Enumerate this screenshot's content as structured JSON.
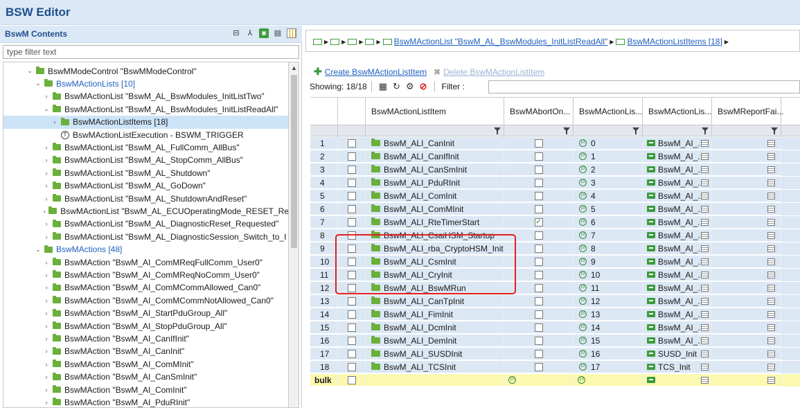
{
  "editor": {
    "title": "BSW Editor"
  },
  "left": {
    "header": "BswM Contents",
    "filter_placeholder": "type filter text",
    "tree": [
      {
        "label": "BswMModeControl \"BswMModeControl\"",
        "indent": 1,
        "chev": "v",
        "kind": "folder"
      },
      {
        "label": "BswMActionLists [10]",
        "indent": 2,
        "chev": "v",
        "kind": "folder",
        "blue": true
      },
      {
        "label": "BswMActionList \"BswM_AL_BswModules_InitListTwo\"",
        "indent": 3,
        "chev": ">",
        "kind": "folder"
      },
      {
        "label": "BswMActionList \"BswM_AL_BswModules_InitListReadAll\"",
        "indent": 3,
        "chev": "v",
        "kind": "folder"
      },
      {
        "label": "BswMActionListItems [18]",
        "indent": 4,
        "chev": ">",
        "kind": "folder",
        "selected": true
      },
      {
        "label": "BswMActionListExecution - BSWM_TRIGGER",
        "indent": 4,
        "chev": "",
        "kind": "t"
      },
      {
        "label": "BswMActionList \"BswM_AL_FullComm_AllBus\"",
        "indent": 3,
        "chev": ">",
        "kind": "folder"
      },
      {
        "label": "BswMActionList \"BswM_AL_StopComm_AllBus\"",
        "indent": 3,
        "chev": ">",
        "kind": "folder"
      },
      {
        "label": "BswMActionList \"BswM_AL_Shutdown\"",
        "indent": 3,
        "chev": ">",
        "kind": "folder"
      },
      {
        "label": "BswMActionList \"BswM_AL_GoDown\"",
        "indent": 3,
        "chev": ">",
        "kind": "folder"
      },
      {
        "label": "BswMActionList \"BswM_AL_ShutdownAndReset\"",
        "indent": 3,
        "chev": ">",
        "kind": "folder"
      },
      {
        "label": "BswMActionList \"BswM_AL_ECUOperatingMode_RESET_Re",
        "indent": 3,
        "chev": ">",
        "kind": "folder"
      },
      {
        "label": "BswMActionList \"BswM_AL_DiagnosticReset_Requested\"",
        "indent": 3,
        "chev": ">",
        "kind": "folder"
      },
      {
        "label": "BswMActionList \"BswM_AL_DiagnosticSession_Switch_to_I",
        "indent": 3,
        "chev": ">",
        "kind": "folder"
      },
      {
        "label": "BswMActions [48]",
        "indent": 2,
        "chev": "v",
        "kind": "folder",
        "blue": true
      },
      {
        "label": "BswMAction \"BswM_AI_ComMReqFullComm_User0\"",
        "indent": 3,
        "chev": ">",
        "kind": "folder"
      },
      {
        "label": "BswMAction \"BswM_AI_ComMReqNoComm_User0\"",
        "indent": 3,
        "chev": ">",
        "kind": "folder"
      },
      {
        "label": "BswMAction \"BswM_AI_ComMCommAllowed_Can0\"",
        "indent": 3,
        "chev": ">",
        "kind": "folder"
      },
      {
        "label": "BswMAction \"BswM_AI_ComMCommNotAllowed_Can0\"",
        "indent": 3,
        "chev": ">",
        "kind": "folder"
      },
      {
        "label": "BswMAction \"BswM_AI_StartPduGroup_All\"",
        "indent": 3,
        "chev": ">",
        "kind": "folder"
      },
      {
        "label": "BswMAction \"BswM_AI_StopPduGroup_All\"",
        "indent": 3,
        "chev": ">",
        "kind": "folder"
      },
      {
        "label": "BswMAction \"BswM_AI_CanIfInit\"",
        "indent": 3,
        "chev": ">",
        "kind": "folder"
      },
      {
        "label": "BswMAction \"BswM_AI_CanInit\"",
        "indent": 3,
        "chev": ">",
        "kind": "folder"
      },
      {
        "label": "BswMAction \"BswM_AI_ComMInit\"",
        "indent": 3,
        "chev": ">",
        "kind": "folder"
      },
      {
        "label": "BswMAction \"BswM_AI_CanSmInit\"",
        "indent": 3,
        "chev": ">",
        "kind": "folder"
      },
      {
        "label": "BswMAction \"BswM_AI_ComInit\"",
        "indent": 3,
        "chev": ">",
        "kind": "folder"
      },
      {
        "label": "BswMAction \"BswM_AI_PduRInit\"",
        "indent": 3,
        "chev": ">",
        "kind": "folder"
      }
    ]
  },
  "right": {
    "breadcrumb": {
      "link1": "BswMActionList \"BswM_AL_BswModules_InitListReadAll\"",
      "link2": "BswMActionListItems [18]"
    },
    "create_label": "Create BswMActionListItem",
    "delete_label": "Delete BswMActionListItem",
    "showing": "Showing: 18/18",
    "filter_label": "Filter :",
    "columns": [
      "BswMActionListItem",
      "BswMAbortOn...",
      "BswMActionLis...",
      "BswMActionLis...",
      "BswMReportFai..."
    ],
    "rows": [
      {
        "n": "1",
        "item": "BswM_ALI_CanInit",
        "abort": false,
        "idx": "0",
        "ref": "BswM_AI_..."
      },
      {
        "n": "2",
        "item": "BswM_ALI_CanIfInit",
        "abort": false,
        "idx": "1",
        "ref": "BswM_AI_..."
      },
      {
        "n": "3",
        "item": "BswM_ALI_CanSmInit",
        "abort": false,
        "idx": "2",
        "ref": "BswM_AI_..."
      },
      {
        "n": "4",
        "item": "BswM_ALI_PduRInit",
        "abort": false,
        "idx": "3",
        "ref": "BswM_AI_..."
      },
      {
        "n": "5",
        "item": "BswM_ALI_ComInit",
        "abort": false,
        "idx": "4",
        "ref": "BswM_AI_..."
      },
      {
        "n": "6",
        "item": "BswM_ALI_ComMInit",
        "abort": false,
        "idx": "5",
        "ref": "BswM_AI_..."
      },
      {
        "n": "7",
        "item": "BswM_ALI_RteTimerStart",
        "abort": true,
        "idx": "6",
        "ref": "BswM_AI_..."
      },
      {
        "n": "8",
        "item": "BswM_ALI_CsaiHSM_Startup",
        "abort": false,
        "idx": "7",
        "ref": "BswM_AI_..."
      },
      {
        "n": "9",
        "item": "BswM_ALI_rba_CryptoHSM_Init",
        "abort": false,
        "idx": "8",
        "ref": "BswM_AI_..."
      },
      {
        "n": "10",
        "item": "BswM_ALI_CsmInit",
        "abort": false,
        "idx": "9",
        "ref": "BswM_AI_..."
      },
      {
        "n": "11",
        "item": "BswM_ALI_CryInit",
        "abort": false,
        "idx": "10",
        "ref": "BswM_AI_..."
      },
      {
        "n": "12",
        "item": "BswM_ALI_BswMRun",
        "abort": false,
        "idx": "11",
        "ref": "BswM_AI_..."
      },
      {
        "n": "13",
        "item": "BswM_ALI_CanTpInit",
        "abort": false,
        "idx": "12",
        "ref": "BswM_AI_..."
      },
      {
        "n": "14",
        "item": "BswM_ALI_FimInit",
        "abort": false,
        "idx": "13",
        "ref": "BswM_AI_..."
      },
      {
        "n": "15",
        "item": "BswM_ALI_DcmInit",
        "abort": false,
        "idx": "14",
        "ref": "BswM_AI_..."
      },
      {
        "n": "16",
        "item": "BswM_ALI_DemInit",
        "abort": false,
        "idx": "15",
        "ref": "BswM_AI_..."
      },
      {
        "n": "17",
        "item": "BswM_ALI_SUSDInit",
        "abort": false,
        "idx": "16",
        "ref": "SUSD_Init"
      },
      {
        "n": "18",
        "item": "BswM_ALI_TCSInit",
        "abort": false,
        "idx": "17",
        "ref": "TCS_Init"
      }
    ],
    "bulk_label": "bulk"
  },
  "colors": {
    "accent": "#1f4e8c",
    "link": "#1f5fbf",
    "row_bg": "#dce7f4",
    "bulk_bg": "#fbf8b0",
    "highlight": "#e02020"
  }
}
